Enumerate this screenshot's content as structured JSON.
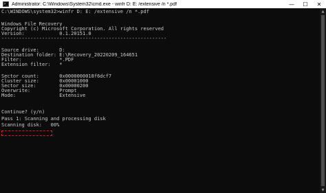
{
  "window": {
    "title": "Administrator: C:\\Windows\\System32\\cmd.exe - winfr  D: E: /extensive /n *.pdf",
    "icon": "cmd-icon",
    "controls": {
      "minimize": "—",
      "maximize": "☐",
      "close": "✕"
    }
  },
  "console": {
    "lines": [
      "C:\\WINDOWS\\system32>winfr D: E: /extensive /n *.pdf",
      "",
      "Windows File Recovery",
      "Copyright (c) Microsoft Corporation. All rights reserved",
      "Version:            0.1.20151.0",
      "---------------------------------------------------------",
      "",
      "Source drive:       D:",
      "Destination folder: E:\\Recovery_20220209_164651",
      "Filter:             *.PDF",
      "Extension filter:   *",
      "",
      "Sector count:       0x0000000018f6dcf7",
      "Cluster size:       0x00001000",
      "Sector size:        0x00000200",
      "Overwrite:          Prompt",
      "Mode:               Extensive",
      "",
      "",
      "Continue? (y/n)",
      "Pass 1: Scanning and processing disk",
      "Scanning disk:   00%"
    ]
  },
  "scrollbar": {
    "up_arrow": "▲",
    "down_arrow": "▼"
  }
}
